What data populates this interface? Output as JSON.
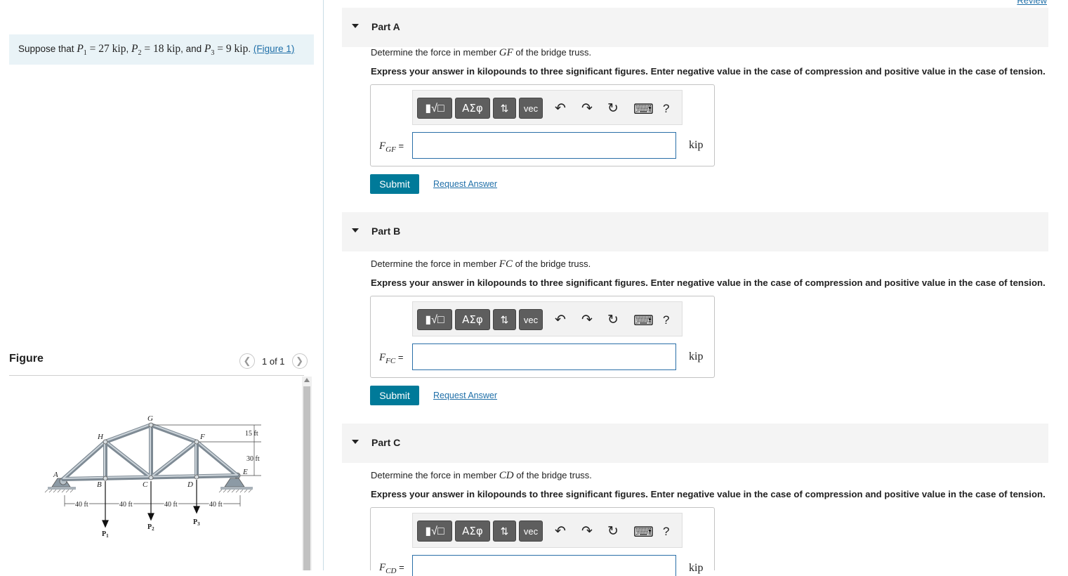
{
  "problem": {
    "prefix": "Suppose that ",
    "p1_sym": "P",
    "p1_sub": "1",
    "p1_val": " = 27 kip",
    "p2_sym": "P",
    "p2_sub": "2",
    "p2_val": " = 18 kip",
    "p3_sym": "P",
    "p3_sub": "3",
    "p3_val": " = 9 kip",
    "sep1": ", ",
    "sep2": ", and ",
    "end": ". ",
    "figure_link": "(Figure 1)"
  },
  "figure": {
    "title": "Figure",
    "pager": "1 of 1",
    "labels": {
      "A": "A",
      "B": "B",
      "C": "C",
      "D": "D",
      "E": "E",
      "F": "F",
      "G": "G",
      "H": "H",
      "dim15": "15 ft",
      "dim30": "30 ft",
      "span1": "40 ft",
      "span2": "40 ft",
      "span3": "40 ft",
      "span4": "40 ft",
      "P1": "P",
      "P1s": "1",
      "P2": "P",
      "P2s": "2",
      "P3": "P",
      "P3s": "3"
    }
  },
  "review_link": "Review",
  "parts": [
    {
      "title": "Part A",
      "q_pre": "Determine the force in member ",
      "q_member": "GF",
      "q_post": " of the bridge truss.",
      "instr": "Express your answer in kilopounds to three significant figures. Enter negative value in the case of compression and positive value in the case of tension.",
      "var": "F",
      "var_sub": "GF",
      "eq": " =",
      "unit": "kip",
      "value": "",
      "submit": "Submit",
      "request": "Request Answer"
    },
    {
      "title": "Part B",
      "q_pre": "Determine the force in member ",
      "q_member": "FC",
      "q_post": " of the bridge truss.",
      "instr": "Express your answer in kilopounds to three significant figures. Enter negative value in the case of compression and positive value in the case of tension.",
      "var": "F",
      "var_sub": "FC",
      "eq": " =",
      "unit": "kip",
      "value": "",
      "submit": "Submit",
      "request": "Request Answer"
    },
    {
      "title": "Part C",
      "q_pre": "Determine the force in member ",
      "q_member": "CD",
      "q_post": " of the bridge truss.",
      "instr": "Express your answer in kilopounds to three significant figures. Enter negative value in the case of compression and positive value in the case of tension.",
      "var": "F",
      "var_sub": "CD",
      "eq": " =",
      "unit": "kip",
      "value": ""
    }
  ],
  "toolbar": {
    "templates": "▮√□",
    "greek": "ΑΣφ",
    "arrows": "⇅",
    "vec": "vec",
    "undo": "↶",
    "redo": "↷",
    "reset": "↻",
    "keyboard": "⌨",
    "help": "?"
  }
}
